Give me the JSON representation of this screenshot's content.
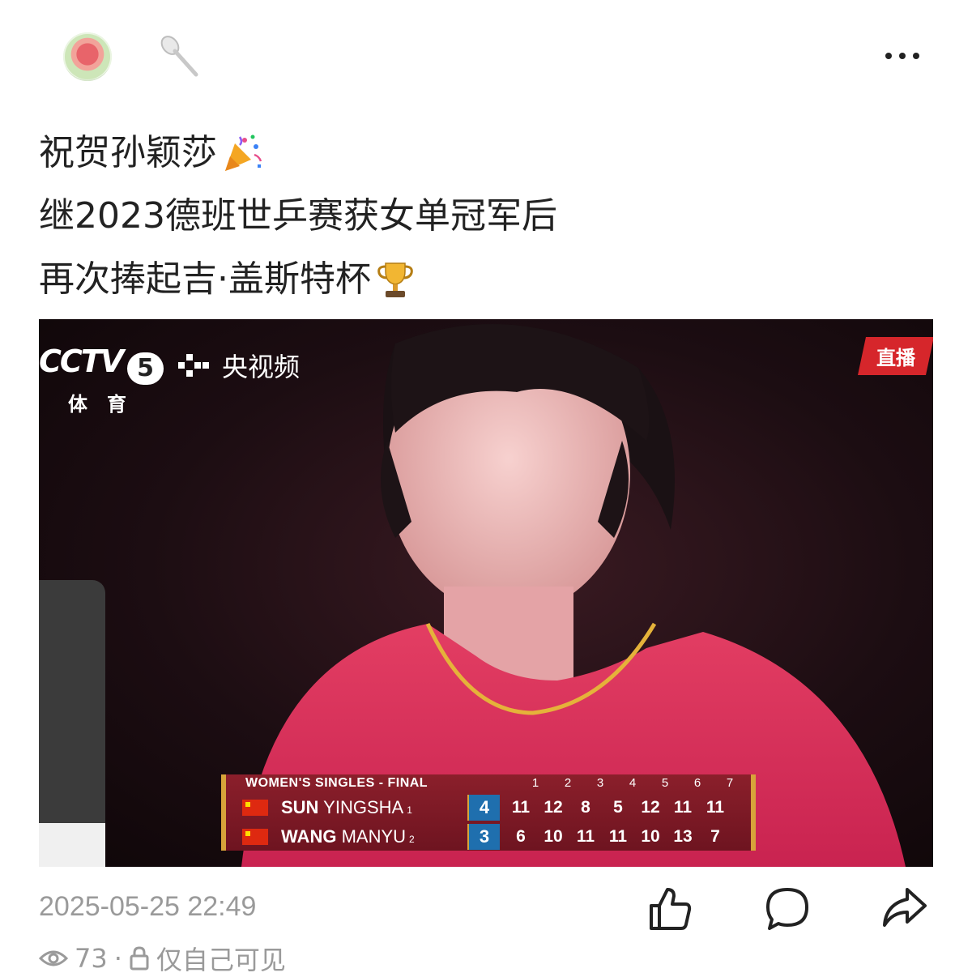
{
  "header": {
    "avatar_icon": "flower-avatar",
    "badge_icon": "spoon-icon",
    "more_icon": "more-icon"
  },
  "post": {
    "lines": [
      "祝贺孙颖莎",
      "继2023德班世乒赛获女单冠军后",
      "再次捧起吉·盖斯特杯"
    ],
    "emoji_line1": "party-popper-icon",
    "emoji_line3": "trophy-icon"
  },
  "media": {
    "channel_logo": "CCTV",
    "channel_number": "5",
    "channel_sub": "体育",
    "platform": "央视频",
    "live_badge": "直播",
    "scoreboard": {
      "title": "WOMEN'S SINGLES - FINAL",
      "game_numbers": [
        "1",
        "2",
        "3",
        "4",
        "5",
        "6",
        "7"
      ],
      "players": [
        {
          "surname": "SUN",
          "given": "YINGSHA",
          "seed": "1",
          "sets": "4",
          "scores": [
            "11",
            "12",
            "8",
            "5",
            "12",
            "11",
            "11"
          ]
        },
        {
          "surname": "WANG",
          "given": "MANYU",
          "seed": "2",
          "sets": "3",
          "scores": [
            "6",
            "10",
            "11",
            "11",
            "10",
            "13",
            "7"
          ]
        }
      ]
    }
  },
  "meta": {
    "timestamp": "2025-05-25 22:49",
    "views": "73",
    "visibility": "仅自己可见"
  },
  "colors": {
    "accent_red": "#d6262b",
    "scoreboard_bg": "#8b1f2b",
    "scoreboard_gold": "#d7a43a",
    "sets_blue": "#1f6fae",
    "meta_gray": "#9a9a9a"
  }
}
